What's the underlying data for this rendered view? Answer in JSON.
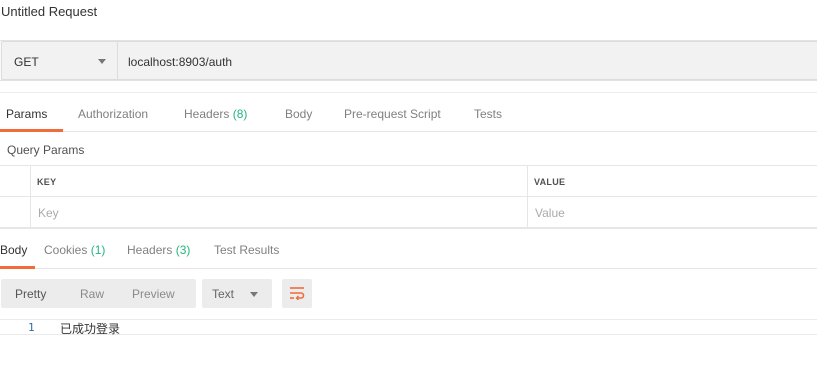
{
  "request": {
    "title": "Untitled Request",
    "method": "GET",
    "url": "localhost:8903/auth"
  },
  "request_tabs": [
    {
      "label": "Params",
      "active": true
    },
    {
      "label": "Authorization"
    },
    {
      "label": "Headers",
      "count": "(8)"
    },
    {
      "label": "Body"
    },
    {
      "label": "Pre-request Script"
    },
    {
      "label": "Tests"
    }
  ],
  "query_params": {
    "section_label": "Query Params",
    "key_header": "KEY",
    "value_header": "VALUE",
    "key_placeholder": "Key",
    "value_placeholder": "Value"
  },
  "response_tabs": [
    {
      "label": "Body",
      "active": true
    },
    {
      "label": "Cookies",
      "count": "(1)"
    },
    {
      "label": "Headers",
      "count": "(3)"
    },
    {
      "label": "Test Results"
    }
  ],
  "response_toolbar": {
    "views": [
      "Pretty",
      "Raw",
      "Preview"
    ],
    "active_view": "Pretty",
    "format": "Text",
    "wrap_icon": "wrap-lines-icon"
  },
  "response_body": {
    "lines": [
      {
        "number": "1",
        "text": "已成功登录"
      }
    ]
  },
  "colors": {
    "accent": "#f26b3a",
    "count": "#26b47f",
    "line_number": "#2c6fad"
  }
}
